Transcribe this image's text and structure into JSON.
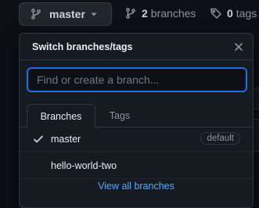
{
  "toolbar": {
    "branch_button_label": "master",
    "branches_count": "2",
    "branches_label": "branches",
    "tags_count": "0",
    "tags_label": "tags"
  },
  "popover": {
    "title": "Switch branches/tags",
    "filter_placeholder": "Find or create a branch...",
    "tabs": [
      {
        "label": "Branches",
        "selected": true
      },
      {
        "label": "Tags",
        "selected": false
      }
    ],
    "branches": [
      {
        "name": "master",
        "checked": true,
        "badge": "default"
      },
      {
        "name": "hello-world-two",
        "checked": false,
        "badge": ""
      }
    ],
    "view_all_label": "View all branches"
  },
  "colors": {
    "background": "#0d1117",
    "overlay": "#161b22",
    "border": "#30363d",
    "accent_focus": "#1f6feb",
    "link": "#58a6ff",
    "text": "#c9d1d9",
    "muted": "#8b949e"
  },
  "icons": [
    "git-branch-icon",
    "caret-down-icon",
    "tag-icon",
    "close-icon",
    "check-icon"
  ]
}
